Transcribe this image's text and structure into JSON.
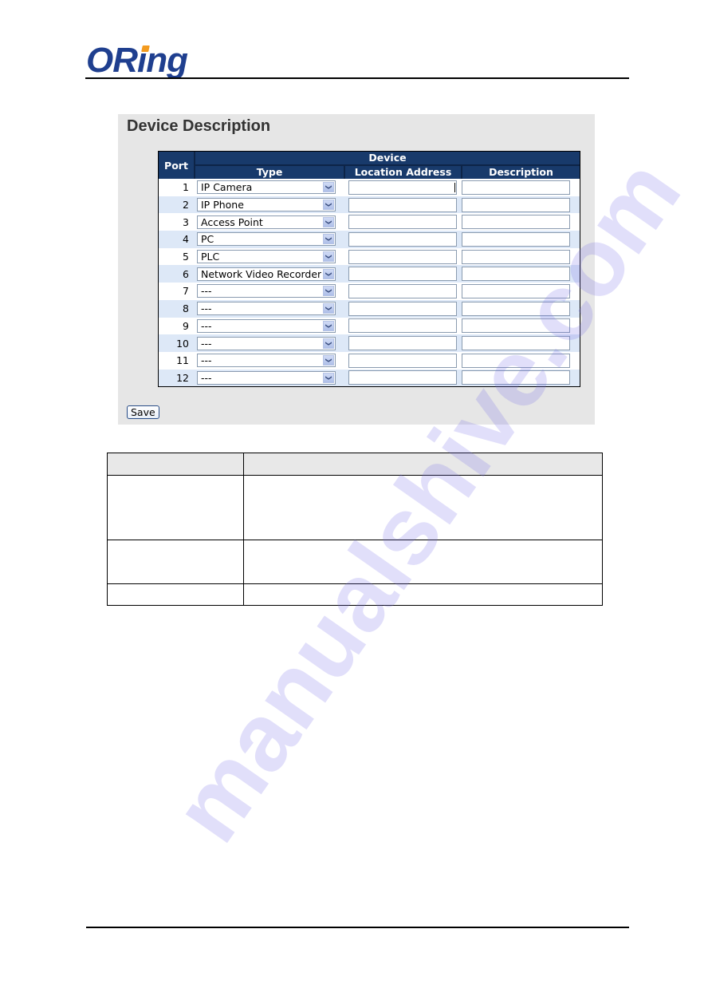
{
  "header": {
    "logo_text_prefix": "O",
    "logo_text_r": "R",
    "logo_text_i": "i",
    "logo_text_suffix": "ng"
  },
  "panel": {
    "title": "Device Description",
    "table": {
      "headers": {
        "port": "Port",
        "device_group": "Device",
        "type": "Type",
        "location_address": "Location Address",
        "description": "Description"
      },
      "rows": [
        {
          "port": "1",
          "type": "IP Camera",
          "location_address": "",
          "description": ""
        },
        {
          "port": "2",
          "type": "IP Phone",
          "location_address": "",
          "description": ""
        },
        {
          "port": "3",
          "type": "Access Point",
          "location_address": "",
          "description": ""
        },
        {
          "port": "4",
          "type": "PC",
          "location_address": "",
          "description": ""
        },
        {
          "port": "5",
          "type": "PLC",
          "location_address": "",
          "description": ""
        },
        {
          "port": "6",
          "type": "Network Video Recorder",
          "location_address": "",
          "description": ""
        },
        {
          "port": "7",
          "type": "---",
          "location_address": "",
          "description": ""
        },
        {
          "port": "8",
          "type": "---",
          "location_address": "",
          "description": ""
        },
        {
          "port": "9",
          "type": "---",
          "location_address": "",
          "description": ""
        },
        {
          "port": "10",
          "type": "---",
          "location_address": "",
          "description": ""
        },
        {
          "port": "11",
          "type": "---",
          "location_address": "",
          "description": ""
        },
        {
          "port": "12",
          "type": "---",
          "location_address": "",
          "description": ""
        }
      ]
    },
    "save_label": "Save"
  },
  "param_table": {
    "rows": [
      {
        "label": "",
        "description": ""
      },
      {
        "label": "",
        "description": ""
      },
      {
        "label": "",
        "description": ""
      },
      {
        "label": "",
        "description": ""
      }
    ]
  },
  "watermark": "manualshive.com",
  "icons": {
    "dropdown_arrow": "chevron-down-icon"
  }
}
